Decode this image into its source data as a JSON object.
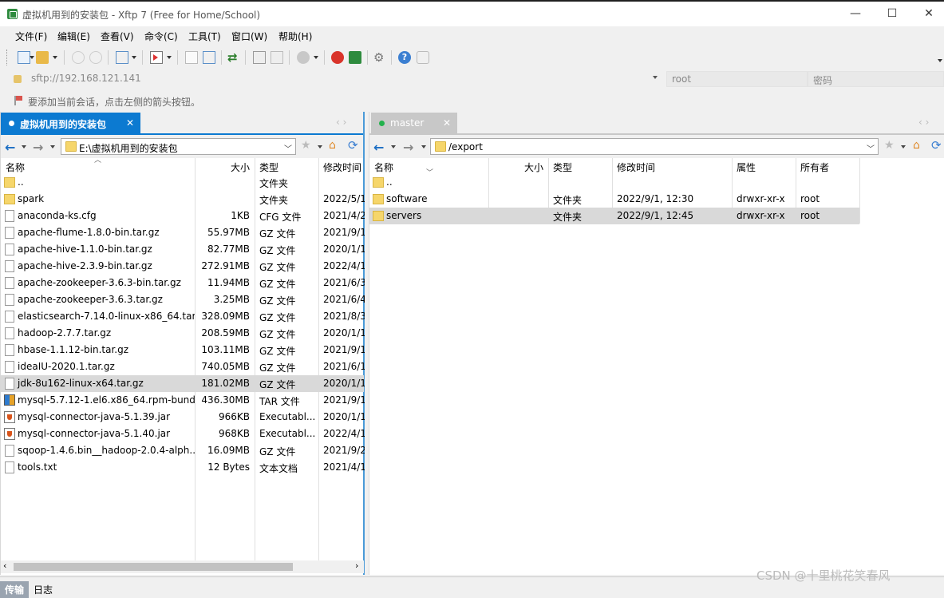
{
  "window": {
    "title": "虚拟机用到的安装包 - Xftp 7 (Free for Home/School)",
    "minimize": "—",
    "maximize": "☐",
    "close": "✕"
  },
  "menu": [
    "文件(F)",
    "编辑(E)",
    "查看(V)",
    "命令(C)",
    "工具(T)",
    "窗口(W)",
    "帮助(H)"
  ],
  "address": {
    "host": "sftp://192.168.121.141",
    "username": "root",
    "password_placeholder": "密码"
  },
  "hint": "要添加当前会话，点击左侧的箭头按钮。",
  "left_panel": {
    "tab_label": "虚拟机用到的安装包",
    "tab_close": "✕",
    "path": "E:\\虚拟机用到的安装包",
    "columns": [
      "名称",
      "大小",
      "类型",
      "修改时间"
    ],
    "rows": [
      {
        "name": "..",
        "size": "",
        "type": "文件夹",
        "modified": "",
        "icon": "folder-icon"
      },
      {
        "name": "spark",
        "size": "",
        "type": "文件夹",
        "modified": "2022/5/1",
        "icon": "folder-icon"
      },
      {
        "name": "anaconda-ks.cfg",
        "size": "1KB",
        "type": "CFG 文件",
        "modified": "2021/4/2",
        "icon": "file-icon"
      },
      {
        "name": "apache-flume-1.8.0-bin.tar.gz",
        "size": "55.97MB",
        "type": "GZ 文件",
        "modified": "2021/9/1",
        "icon": "file-icon"
      },
      {
        "name": "apache-hive-1.1.0-bin.tar.gz",
        "size": "82.77MB",
        "type": "GZ 文件",
        "modified": "2020/1/1",
        "icon": "file-icon"
      },
      {
        "name": "apache-hive-2.3.9-bin.tar.gz",
        "size": "272.91MB",
        "type": "GZ 文件",
        "modified": "2022/4/1",
        "icon": "file-icon"
      },
      {
        "name": "apache-zookeeper-3.6.3-bin.tar.gz",
        "size": "11.94MB",
        "type": "GZ 文件",
        "modified": "2021/6/3",
        "icon": "file-icon"
      },
      {
        "name": "apache-zookeeper-3.6.3.tar.gz",
        "size": "3.25MB",
        "type": "GZ 文件",
        "modified": "2021/6/4",
        "icon": "file-icon"
      },
      {
        "name": "elasticsearch-7.14.0-linux-x86_64.tar....",
        "size": "328.09MB",
        "type": "GZ 文件",
        "modified": "2021/8/3",
        "icon": "file-icon"
      },
      {
        "name": "hadoop-2.7.7.tar.gz",
        "size": "208.59MB",
        "type": "GZ 文件",
        "modified": "2020/1/1",
        "icon": "file-icon"
      },
      {
        "name": "hbase-1.1.12-bin.tar.gz",
        "size": "103.11MB",
        "type": "GZ 文件",
        "modified": "2021/9/1",
        "icon": "file-icon"
      },
      {
        "name": "ideaIU-2020.1.tar.gz",
        "size": "740.05MB",
        "type": "GZ 文件",
        "modified": "2021/6/1",
        "icon": "file-icon"
      },
      {
        "name": "jdk-8u162-linux-x64.tar.gz",
        "size": "181.02MB",
        "type": "GZ 文件",
        "modified": "2020/1/1",
        "icon": "file-icon",
        "selected": true
      },
      {
        "name": "mysql-5.7.12-1.el6.x86_64.rpm-bund...",
        "size": "436.30MB",
        "type": "TAR 文件",
        "modified": "2021/9/1",
        "icon": "rpm-icon"
      },
      {
        "name": "mysql-connector-java-5.1.39.jar",
        "size": "966KB",
        "type": "Executabl...",
        "modified": "2020/1/1",
        "icon": "jar-icon"
      },
      {
        "name": "mysql-connector-java-5.1.40.jar",
        "size": "968KB",
        "type": "Executabl...",
        "modified": "2022/4/1",
        "icon": "jar-icon"
      },
      {
        "name": "sqoop-1.4.6.bin__hadoop-2.0.4-alph...",
        "size": "16.09MB",
        "type": "GZ 文件",
        "modified": "2021/9/2",
        "icon": "file-icon"
      },
      {
        "name": "tools.txt",
        "size": "12 Bytes",
        "type": "文本文档",
        "modified": "2021/4/1",
        "icon": "file-icon"
      }
    ]
  },
  "right_panel": {
    "tab_label": "master",
    "tab_close": "✕",
    "path": "/export",
    "columns": [
      "名称",
      "大小",
      "类型",
      "修改时间",
      "属性",
      "所有者"
    ],
    "rows": [
      {
        "name": "..",
        "size": "",
        "type": "",
        "modified": "",
        "attrs": "",
        "owner": ""
      },
      {
        "name": "software",
        "size": "",
        "type": "文件夹",
        "modified": "2022/9/1, 12:30",
        "attrs": "drwxr-xr-x",
        "owner": "root"
      },
      {
        "name": "servers",
        "size": "",
        "type": "文件夹",
        "modified": "2022/9/1, 12:45",
        "attrs": "drwxr-xr-x",
        "owner": "root",
        "selected": true
      }
    ]
  },
  "bottom_tabs": [
    "传输",
    "日志"
  ],
  "watermark": "CSDN @十里桃花笑春风",
  "colors": {
    "accent": "#0c7ad1",
    "selected_row": "#d9d9d9",
    "connected_dot": "#22b14c"
  }
}
